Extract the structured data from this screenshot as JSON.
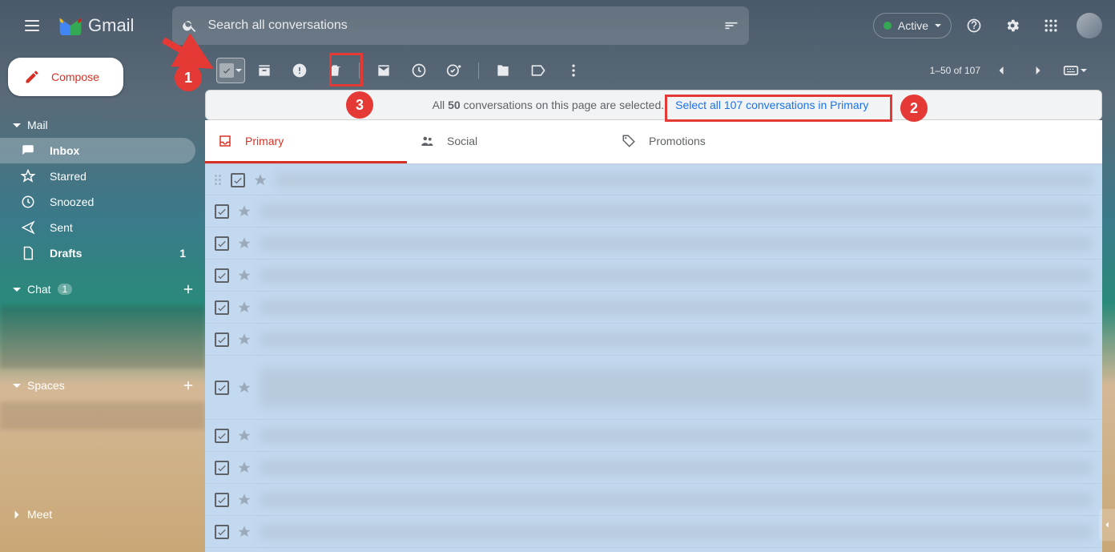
{
  "app": {
    "name": "Gmail"
  },
  "search": {
    "placeholder": "Search all conversations"
  },
  "status": {
    "label": "Active"
  },
  "compose_label": "Compose",
  "sections": {
    "mail": "Mail",
    "chat": "Chat",
    "chat_badge": "1",
    "spaces": "Spaces",
    "meet": "Meet"
  },
  "nav": {
    "inbox": "Inbox",
    "starred": "Starred",
    "snoozed": "Snoozed",
    "sent": "Sent",
    "drafts": "Drafts",
    "drafts_count": "1"
  },
  "pager": {
    "text": "1–50 of 107"
  },
  "banner": {
    "prefix": "All ",
    "bold": "50",
    "suffix": " conversations on this page are selected.",
    "link": "Select all 107 conversations in Primary"
  },
  "tabs": {
    "primary": "Primary",
    "social": "Social",
    "promotions": "Promotions"
  },
  "annotations": {
    "one": "1",
    "two": "2",
    "three": "3"
  }
}
